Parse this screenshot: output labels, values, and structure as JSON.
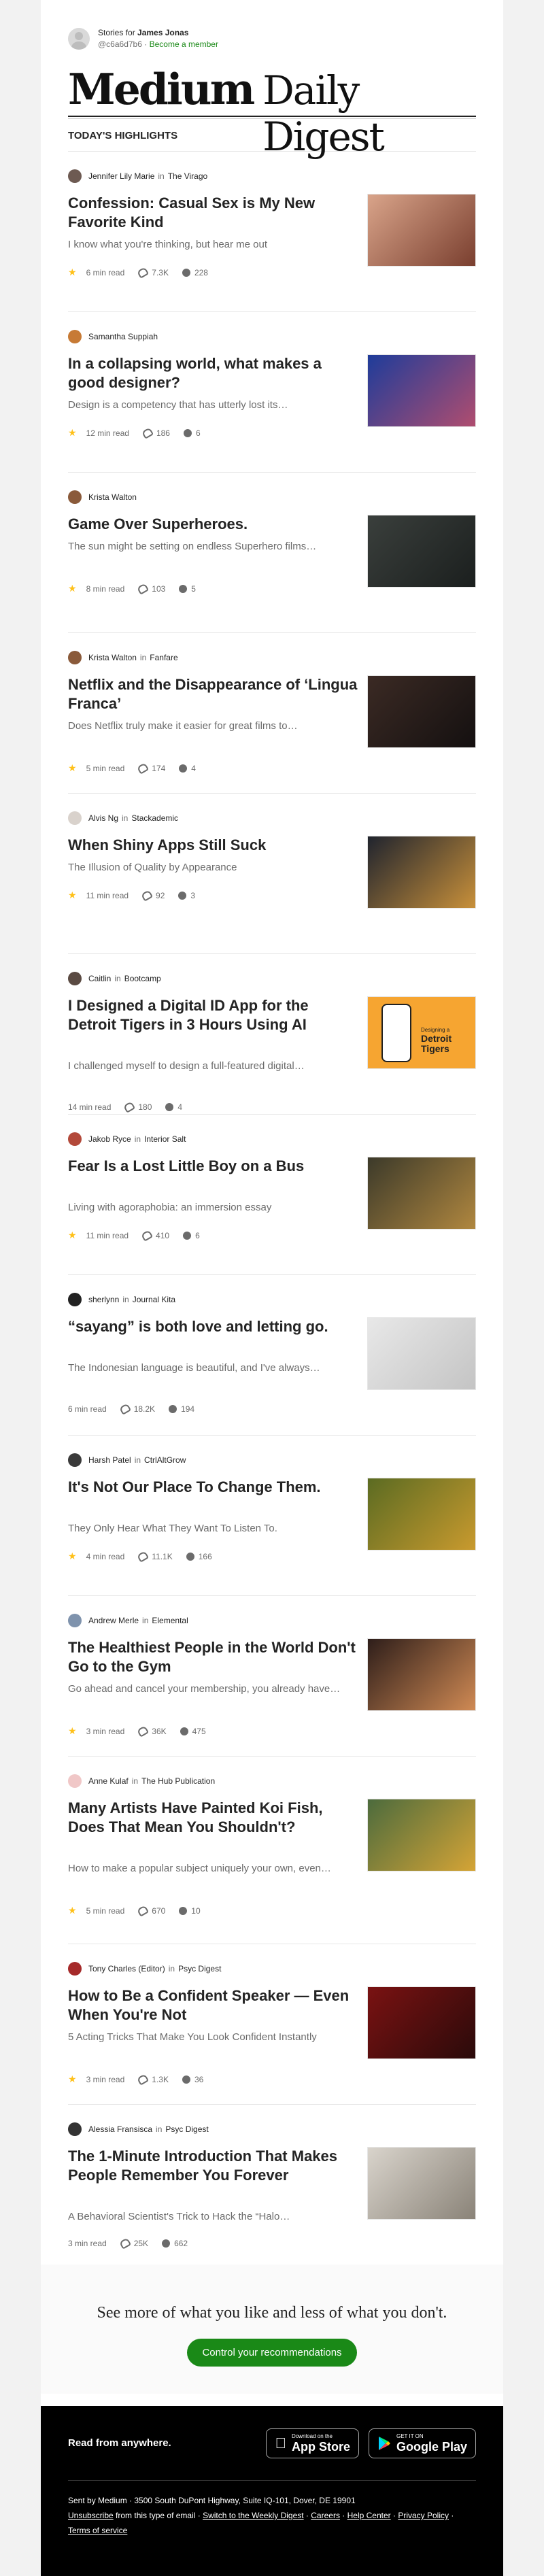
{
  "header": {
    "stories_for": "Stories for",
    "user_name": "James Jonas",
    "handle": "@c6a6d7b6",
    "separator": "·",
    "become_member": "Become a member"
  },
  "brand": {
    "medium": "Medium",
    "daily_digest": "Daily Digest"
  },
  "section_title": "TODAY'S HIGHLIGHTS",
  "articles": [
    {
      "author": "Jennifer Lily Marie",
      "in": "in",
      "publication": "The Virago",
      "title": "Confession: Casual Sex is My New Favorite Kind",
      "subtitle": "I know what you're thinking, but hear me out",
      "read_time": "6 min read",
      "claps": "7.3K",
      "responses": "228",
      "starred": true,
      "avatar_color": "#6d5a52",
      "thumb_colors": [
        "#d9a48a",
        "#7a3f2f"
      ]
    },
    {
      "author": "Samantha Suppiah",
      "in": "",
      "publication": "",
      "title": "In a collapsing world, what makes a good designer?",
      "subtitle": "Design is a competency that has utterly lost its…",
      "read_time": "12 min read",
      "claps": "186",
      "responses": "6",
      "starred": true,
      "avatar_color": "#c77a35",
      "thumb_colors": [
        "#1e3c9a",
        "#b04d6f"
      ]
    },
    {
      "author": "Krista Walton",
      "in": "",
      "publication": "",
      "title": "Game Over Superheroes.",
      "subtitle": "The sun might be setting on endless Superhero films…",
      "read_time": "8 min read",
      "claps": "103",
      "responses": "5",
      "starred": true,
      "avatar_color": "#8a5a3a",
      "thumb_colors": [
        "#3a3f3c",
        "#1b1f1e"
      ]
    },
    {
      "author": "Krista Walton",
      "in": "in",
      "publication": "Fanfare",
      "title": "Netflix and the Disappearance of ‘Lingua Franca’",
      "subtitle": "Does Netflix truly make it easier for great films to…",
      "read_time": "5 min read",
      "claps": "174",
      "responses": "4",
      "starred": true,
      "avatar_color": "#8a5a3a",
      "thumb_colors": [
        "#3b2a24",
        "#141010"
      ]
    },
    {
      "author": "Alvis Ng",
      "in": "in",
      "publication": "Stackademic",
      "title": "When Shiny Apps Still Suck",
      "subtitle": "The Illusion of Quality by Appearance",
      "read_time": "11 min read",
      "claps": "92",
      "responses": "3",
      "starred": true,
      "avatar_color": "#d9d2cc",
      "thumb_colors": [
        "#20242e",
        "#c8903a"
      ]
    },
    {
      "author": "Caitlin",
      "in": "in",
      "publication": "Bootcamp",
      "title": "I Designed a Digital ID App for the Detroit Tigers in 3 Hours Using AI",
      "subtitle": "I challenged myself to design a full-featured digital…",
      "read_time": "14 min read",
      "claps": "180",
      "responses": "4",
      "starred": false,
      "avatar_color": "#5a4a42",
      "thumb_colors": [
        "#f6a531",
        "#f6a531"
      ],
      "thumb_label_top": "Designing a",
      "thumb_label_main": "Detroit",
      "thumb_label_main2": "Tigers"
    },
    {
      "author": "Jakob Ryce",
      "in": "in",
      "publication": "Interior Salt",
      "title": "Fear Is a Lost Little Boy on a Bus",
      "subtitle": "Living with agoraphobia: an immersion essay",
      "read_time": "11 min read",
      "claps": "410",
      "responses": "6",
      "starred": true,
      "avatar_color": "#b3493a",
      "thumb_colors": [
        "#3c3a2a",
        "#b0873f"
      ]
    },
    {
      "author": "sherlynn",
      "in": "in",
      "publication": "Journal Kita",
      "title": "“sayang” is both love and letting go.",
      "subtitle": "The Indonesian language is beautiful, and I've always…",
      "read_time": "6 min read",
      "claps": "18.2K",
      "responses": "194",
      "starred": false,
      "avatar_color": "#222222",
      "thumb_colors": [
        "#e8e8e8",
        "#c4c4c4"
      ]
    },
    {
      "author": "Harsh Patel",
      "in": "in",
      "publication": "CtrlAltGrow",
      "title": "It's Not Our Place To Change Them.",
      "subtitle": "They Only Hear What They Want To Listen To.",
      "read_time": "4 min read",
      "claps": "11.1K",
      "responses": "166",
      "starred": true,
      "avatar_color": "#3a3a3a",
      "thumb_colors": [
        "#5b6b22",
        "#c99a2e"
      ]
    },
    {
      "author": "Andrew Merle",
      "in": "in",
      "publication": "Elemental",
      "title": "The Healthiest People in the World Don't Go to the Gym",
      "subtitle": "Go ahead and cancel your membership, you already have…",
      "read_time": "3 min read",
      "claps": "36K",
      "responses": "475",
      "starred": true,
      "avatar_color": "#7f93ad",
      "thumb_colors": [
        "#2e1e1a",
        "#d08a54"
      ]
    },
    {
      "author": "Anne Kulaf",
      "in": "in",
      "publication": "The Hub Publication",
      "title": "Many Artists Have Painted Koi Fish, Does That Mean You Shouldn't?",
      "subtitle": "How to make a popular subject uniquely your own, even…",
      "read_time": "5 min read",
      "claps": "670",
      "responses": "10",
      "starred": true,
      "avatar_color": "#f0c7c7",
      "thumb_colors": [
        "#4c6b3d",
        "#d5a436"
      ]
    },
    {
      "author": "Tony Charles (Editor)",
      "in": "in",
      "publication": "Psyc Digest",
      "title": "How to Be a Confident Speaker — Even When You're Not",
      "subtitle": "5 Acting Tricks That Make You Look Confident Instantly",
      "read_time": "3 min read",
      "claps": "1.3K",
      "responses": "36",
      "starred": true,
      "avatar_color": "#a52a2a",
      "thumb_colors": [
        "#7a1212",
        "#2a0a0a"
      ]
    },
    {
      "author": "Alessia Fransisca",
      "in": "in",
      "publication": "Psyc Digest",
      "title": "The 1-Minute Introduction That Makes People Remember You Forever",
      "subtitle": "A Behavioral Scientist's Trick to Hack the “Halo…",
      "read_time": "3 min read",
      "claps": "25K",
      "responses": "662",
      "starred": false,
      "avatar_color": "#333333",
      "thumb_colors": [
        "#d9d4cc",
        "#8a8378"
      ]
    }
  ],
  "cta": {
    "text": "See more of what you like and less of what you don't.",
    "button": "Control your recommendations"
  },
  "footer": {
    "read_from_anywhere": "Read from anywhere.",
    "app_store_small": "Download on the",
    "app_store_big": "App Store",
    "google_play_small": "GET IT ON",
    "google_play_big": "Google Play",
    "sent_by": "Sent by Medium · 3500 South DuPont Highway, Suite IQ-101, Dover, DE 19901",
    "unsubscribe": "Unsubscribe",
    "unsubscribe_rest": " from this type of email · ",
    "switch_weekly": "Switch to the Weekly Digest",
    "sep1": " · ",
    "careers": "Careers",
    "sep2": " · ",
    "help_center": "Help Center",
    "sep3": " · ",
    "privacy_policy": "Privacy Policy",
    "sep4": " · ",
    "terms": "Terms of service"
  }
}
